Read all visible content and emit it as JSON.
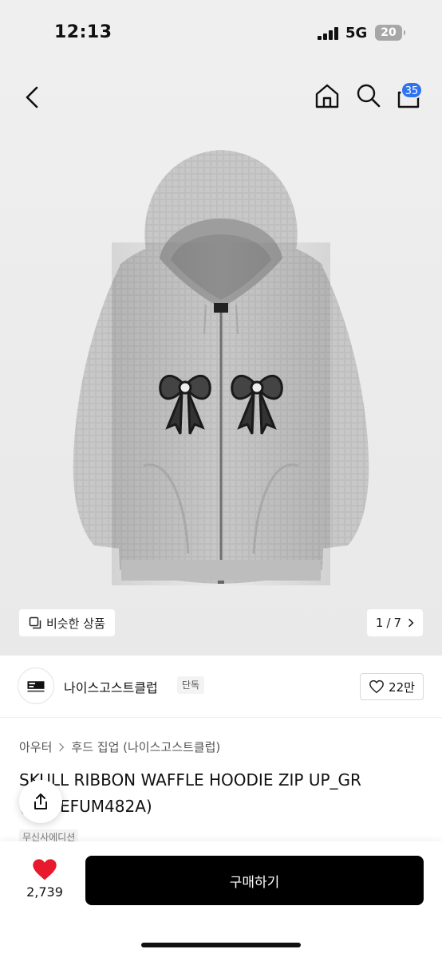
{
  "status_bar": {
    "time": "12:13",
    "network": "5G",
    "battery": "20"
  },
  "header": {
    "cart_count": "35"
  },
  "gallery": {
    "similar_label": "비슷한 상품",
    "current": "1",
    "total": "7",
    "pager_separator": "/"
  },
  "brand": {
    "name": "나이스고스트클럽",
    "badge": "단독",
    "like_count": "22만"
  },
  "category": {
    "level1": "아우터",
    "level2": "후드 집업 (나이스고스트클럽)"
  },
  "product": {
    "title": "SKULL RIBBON WAFFLE HOODIE ZIP UP_GR",
    "title_line2": "(NG2EFUM482A)",
    "edition_badge": "무신사에디션"
  },
  "bottom_bar": {
    "wish_count": "2,739",
    "buy_label": "구매하기"
  },
  "colors": {
    "accent_blue": "#2f73f0",
    "heart_red": "#e8192c",
    "buy_bg": "#000000"
  },
  "icons": [
    "back-icon",
    "home-icon",
    "search-icon",
    "cart-icon",
    "similar-items-icon",
    "chevron-right-icon",
    "heart-outline-icon",
    "share-icon",
    "heart-filled-icon"
  ]
}
